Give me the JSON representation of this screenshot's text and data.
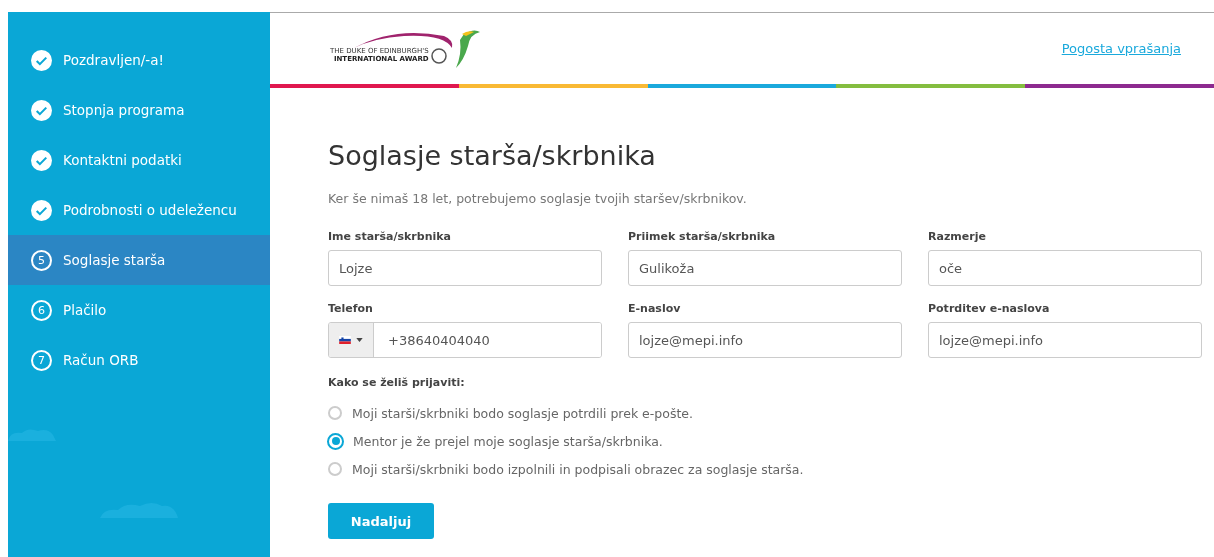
{
  "sidebar": {
    "items": [
      {
        "label": "Pozdravljen/-a!",
        "kind": "done",
        "selected": false
      },
      {
        "label": "Stopnja programa",
        "kind": "done",
        "selected": false
      },
      {
        "label": "Kontaktni podatki",
        "kind": "done",
        "selected": false
      },
      {
        "label": "Podrobnosti o udeležencu",
        "kind": "done",
        "selected": false
      },
      {
        "label": "Soglasje starša",
        "kind": "step",
        "number": "5",
        "selected": true
      },
      {
        "label": "Plačilo",
        "kind": "step",
        "number": "6",
        "selected": false
      },
      {
        "label": "Račun ORB",
        "kind": "step",
        "number": "7",
        "selected": false
      }
    ]
  },
  "header": {
    "logo": {
      "line_1": "THE DUKE OF EDINBURGH'S",
      "line_2": "INTERNATIONAL AWARD"
    },
    "link": "Pogosta vprašanja"
  },
  "title": "Soglasje starša/skrbnika",
  "subtitle": "Ker še nimaš 18 let, potrebujemo soglasje tvojih staršev/skrbnikov.",
  "fields": [
    {
      "label": "Ime starša/skrbnika",
      "value": "Lojze",
      "kind": "text"
    },
    {
      "label": "Priimek starša/skrbnika",
      "value": "Gulikoža",
      "kind": "text"
    },
    {
      "label": "Razmerje",
      "value": "oče",
      "kind": "text"
    },
    {
      "label": "Telefon",
      "value": "+38640404040",
      "kind": "phone"
    },
    {
      "label": "E-naslov",
      "value": "lojze@mepi.info",
      "kind": "text"
    },
    {
      "label": "Potrditev e-naslova",
      "value": "lojze@mepi.info",
      "kind": "text"
    }
  ],
  "question": "Kako se želiš prijaviti:",
  "options": [
    {
      "label": "Moji starši/skrbniki bodo soglasje potrdili prek e-pošte.",
      "selected": false
    },
    {
      "label": "Mentor je že prejel moje soglasje starša/skrbnika.",
      "selected": true
    },
    {
      "label": "Moji starši/skrbniki bodo izpolnili in podpisali obrazec za soglasje starša.",
      "selected": false
    }
  ],
  "button": "Nadaljuj"
}
